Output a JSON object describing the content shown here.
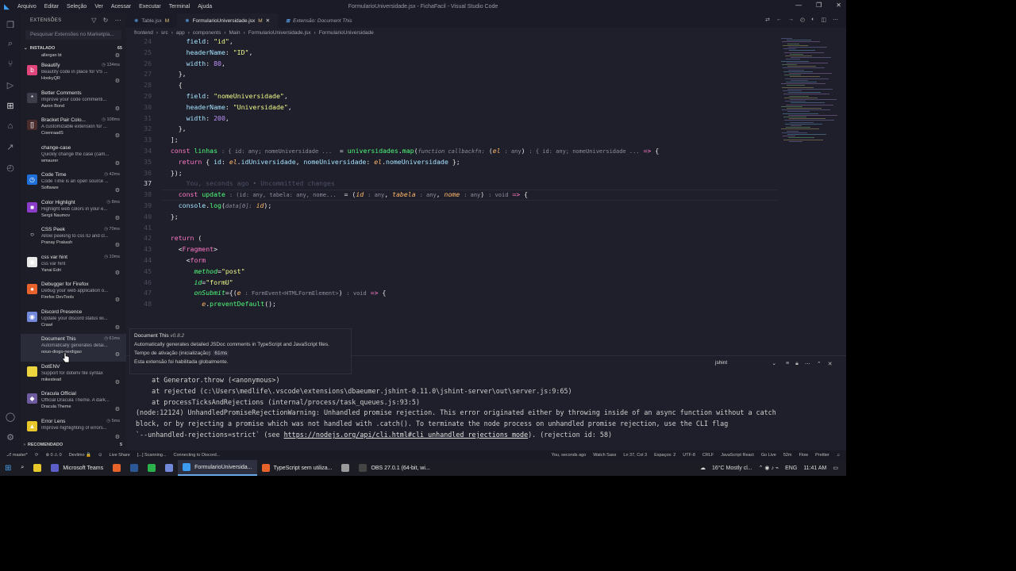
{
  "window": {
    "title": "FormularioUniversidade.jsx - FichaFacil - Visual Studio Code",
    "menu": [
      "Arquivo",
      "Editar",
      "Seleção",
      "Ver",
      "Acessar",
      "Executar",
      "Terminal",
      "Ajuda"
    ]
  },
  "sidebar": {
    "header": "EXTENSÕES",
    "search_placeholder": "Pesquisar Extensões no Marketpla...",
    "installed_label": "INSTALADO",
    "installed_count": "65",
    "top_partial": "allergan bt",
    "extensions": [
      {
        "name": "Beautify",
        "desc": "Beautify code in place for VS ...",
        "publisher": "HookyQR",
        "time": "134ms",
        "icon_color": "#e0457b",
        "icon": "b"
      },
      {
        "name": "Better Comments",
        "desc": "Improve your code commenti...",
        "publisher": "Aaron Bond",
        "time": "",
        "icon_color": "#3c3c4a",
        "icon": "*"
      },
      {
        "name": "Bracket Pair Colo...",
        "desc": "A customizable extension for ...",
        "publisher": "CoenraadS",
        "time": "108ms",
        "icon_color": "#4a2c2c",
        "icon": "[]"
      },
      {
        "name": "change-case",
        "desc": "Quickly change the case (cam...",
        "publisher": "wmaurer",
        "time": "",
        "icon_color": "#1c1d27",
        "icon": ""
      },
      {
        "name": "Code Time",
        "desc": "Code Time is an open source ...",
        "publisher": "Software",
        "time": "42ms",
        "icon_color": "#1e6fd9",
        "icon": "◷"
      },
      {
        "name": "Color Highlight",
        "desc": "Highlight web colors in your e...",
        "publisher": "Sergii Naumov",
        "time": "8ms",
        "icon_color": "#8a3cc8",
        "icon": "■"
      },
      {
        "name": "CSS Peek",
        "desc": "Allow peeking to css ID and cl...",
        "publisher": "Pranay Prakash",
        "time": "70ms",
        "icon_color": "#1c1d27",
        "icon": "○"
      },
      {
        "name": "css var hint",
        "desc": "css var hint",
        "publisher": "Yanai Edri",
        "time": "10ms",
        "icon_color": "#e8e8e8",
        "icon": "▣"
      },
      {
        "name": "Debugger for Firefox",
        "desc": "Debug your web application o...",
        "publisher": "Firefox DevTools",
        "time": "",
        "icon_color": "#e8632b",
        "icon": "●"
      },
      {
        "name": "Discord Presence",
        "desc": "Update your discord status wi...",
        "publisher": "Crawl",
        "time": "",
        "icon_color": "#7289da",
        "icon": "◉"
      },
      {
        "name": "Document This",
        "desc": "Automatically generates detai...",
        "publisher": "oouo-diogo-perdigao",
        "time": "61ms",
        "icon_color": "#2a2c3a",
        "icon": ""
      },
      {
        "name": "DotENV",
        "desc": "Support for dotenv file syntax",
        "publisher": "mikestead",
        "time": "",
        "icon_color": "#ecd53f",
        "icon": ""
      },
      {
        "name": "Dracula Official",
        "desc": "Official Dracula Theme. A dark...",
        "publisher": "Dracula Theme",
        "time": "",
        "icon_color": "#6e5a9e",
        "icon": "◆"
      },
      {
        "name": "Error Lens",
        "desc": "Improve highlighting of errors...",
        "publisher": "",
        "time": "5ms",
        "icon_color": "#e8c72b",
        "icon": "▲"
      }
    ],
    "recommended_label": "RECOMENDADO",
    "recommended_count": "5"
  },
  "tabs": [
    {
      "label": "Table.jsx",
      "suffix": "M",
      "active": false,
      "italic": false
    },
    {
      "label": "FormularioUniversidade.jsx",
      "suffix": "M",
      "active": true,
      "italic": false
    },
    {
      "label": "Extensão: Document This",
      "suffix": "",
      "active": false,
      "italic": true
    }
  ],
  "breadcrumb": [
    "frontend",
    "src",
    "app",
    "components",
    "Main",
    "FormularioUniversidade.jsx",
    "FormularioUniversidade"
  ],
  "editor": {
    "lines": [
      {
        "num": "24",
        "html": "      <span class='prop'>field</span>: <span class='s'>\"id\"</span>,"
      },
      {
        "num": "25",
        "html": "      <span class='prop'>headerName</span>: <span class='s'>\"ID\"</span>,"
      },
      {
        "num": "26",
        "html": "      <span class='prop'>width</span>: <span class='n'>80</span>,"
      },
      {
        "num": "27",
        "html": "    },"
      },
      {
        "num": "28",
        "html": "    {"
      },
      {
        "num": "29",
        "html": "      <span class='prop'>field</span>: <span class='s'>\"nomeUniversidade\"</span>,"
      },
      {
        "num": "30",
        "html": "      <span class='prop'>headerName</span>: <span class='s'>\"Universidade\"</span>,"
      },
      {
        "num": "31",
        "html": "      <span class='prop'>width</span>: <span class='n'>200</span>,"
      },
      {
        "num": "32",
        "html": "    },"
      },
      {
        "num": "33",
        "html": "  ];"
      },
      {
        "num": "34",
        "html": "  <span class='k'>const</span> <span class='f'>linhas</span> <span class='hint'>: { id: any; nomeUniversidade ...</span>  = <span class='f'>universidades</span>.<span class='f'>map</span>(<span class='hint'><i>function callbackfn:</i></span> (<span class='p'>el</span> <span class='hint'>: any</span>) <span class='hint'>: { id: any; nomeUniversidade ...</span> <span class='k'>=&gt;</span> {"
      },
      {
        "num": "35",
        "html": "    <span class='k'>return</span> { <span class='prop'>id</span>: <span class='p'>el</span>.<span class='prop'>idUniversidade</span>, <span class='prop'>nomeUniversidade</span>: <span class='p'>el</span>.<span class='prop'>nomeUniversidade</span> };"
      },
      {
        "num": "36",
        "html": "  });"
      },
      {
        "num": "37",
        "html": "      <span class='c'>You, seconds ago • Uncommitted changes</span>",
        "current": true
      },
      {
        "num": "38",
        "html": "    <span class='k'>const</span> <span class='f'>update</span> <span class='hint'>: (id: any, tabela: any, nome...</span>  = (<span class='p'>id</span> <span class='hint'>: any</span>, <span class='p'>tabela</span> <span class='hint'>: any</span>, <span class='p'>nome</span> <span class='hint'>: any</span>) <span class='hint'>: void</span> <span class='k'>=&gt;</span> {"
      },
      {
        "num": "39",
        "html": "    <span class='prop'>console</span>.<span class='f'>log</span>(<span class='hint'><i>data[0]:</i></span> <span class='p'>id</span>);"
      },
      {
        "num": "40",
        "html": "  };"
      },
      {
        "num": "41",
        "html": ""
      },
      {
        "num": "42",
        "html": "  <span class='k'>return</span> ("
      },
      {
        "num": "43",
        "html": "    &lt;<span class='tag'>Fragment</span>&gt;"
      },
      {
        "num": "44",
        "html": "      &lt;<span class='tag'>form</span>"
      },
      {
        "num": "45",
        "html": "        <span class='attr'>method</span>=<span class='s'>\"post\"</span>"
      },
      {
        "num": "46",
        "html": "        <span class='attr'>id</span>=<span class='s'>\"formU\"</span>"
      },
      {
        "num": "47",
        "html": "        <span class='attr'>onSubmit</span>={(<span class='p'>e</span> <span class='hint'>: FormEvent&lt;HTMLFormElement&gt;</span>) <span class='hint'>: void</span> <span class='k'>=&gt;</span> {"
      },
      {
        "num": "48",
        "html": "          <span class='p'>e</span>.<span class='f'>preventDefault</span>();"
      }
    ]
  },
  "hover": {
    "title": "Document This",
    "version": "v0.8.2",
    "desc": "Automatically generates detailed JSDoc comments in TypeScript and JavaScript files.",
    "activation_label": "Tempo de ativação (inicialização):",
    "activation_value": "61ms",
    "global_note": "Esta extensão foi habilitada globalmente."
  },
  "panel": {
    "output_channel": "jshint",
    "lines": [
      "    at Generator.throw (<anonymous>)",
      "    at rejected (c:\\Users\\medlife\\.vscode\\extensions\\dbaeumer.jshint-0.11.0\\jshint-server\\out\\server.js:9:65)",
      "    at processTicksAndRejections (internal/process/task_queues.js:93:5)",
      "(node:12124) UnhandledPromiseRejectionWarning: Unhandled promise rejection. This error originated either by throwing inside of an async function without a catch",
      "block, or by rejecting a promise which was not handled with .catch(). To terminate the node process on unhandled promise rejection, use the CLI flag"
    ],
    "last_line_prefix": "`--unhandled-rejections=strict` (see ",
    "last_line_link": "https://nodejs.org/api/cli.html#cli_unhandled_rejections_mode",
    "last_line_suffix": "). (rejection id: 58)"
  },
  "statusbar": {
    "left": [
      "⎇ master*",
      "⟳",
      "⊗ 0 ⚠ 0",
      "Devlimo 🔒",
      "⊙",
      "Live Share",
      "[...] Scanning...",
      "Connecting to Discord..."
    ],
    "right": [
      "You, seconds ago",
      "Watch Sass",
      "Ln 37, Col 3",
      "Espaços: 2",
      "UTF-8",
      "CRLF",
      "JavaScript React",
      "Go Live",
      "52m",
      "Flow",
      "Prettier"
    ]
  },
  "taskbar": {
    "items": [
      {
        "label": "Microsoft Teams",
        "color": "#5b5fc7",
        "active": false
      },
      {
        "label": "",
        "color": "#e8632b",
        "active": false
      },
      {
        "label": "",
        "color": "#2b5797",
        "active": false
      },
      {
        "label": "",
        "color": "#2bb24c",
        "active": false
      },
      {
        "label": "",
        "color": "#7289da",
        "active": false
      },
      {
        "label": "FormularioUniversida...",
        "color": "#3b9cf0",
        "active": true
      },
      {
        "label": "TypeScript sem utiliza...",
        "color": "#e8632b",
        "active": false
      },
      {
        "label": "",
        "color": "#9a9a9a",
        "active": false
      },
      {
        "label": "OBS 27.0.1 (64-bit, wi...",
        "color": "#444",
        "active": false
      }
    ],
    "weather": "16°C  Mostly cl...",
    "language": "ENG",
    "clock": "11:41 AM"
  }
}
